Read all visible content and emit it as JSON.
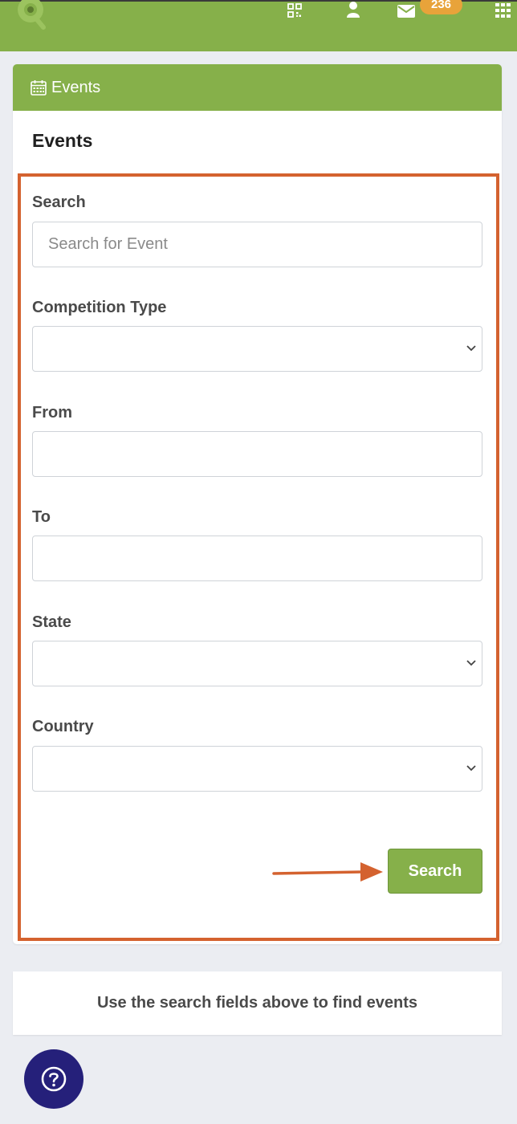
{
  "topbar": {
    "icons": [
      "logo-icon",
      "qr-code-icon",
      "user-icon",
      "mail-icon",
      "apps-grid-icon"
    ],
    "mail_badge": "236",
    "color": "#86b04a"
  },
  "card": {
    "header_label": "Events",
    "title": "Events"
  },
  "form": {
    "search": {
      "label": "Search",
      "placeholder": "Search for Event",
      "value": ""
    },
    "competition_type": {
      "label": "Competition Type",
      "value": ""
    },
    "from": {
      "label": "From",
      "value": ""
    },
    "to": {
      "label": "To",
      "value": ""
    },
    "state": {
      "label": "State",
      "value": ""
    },
    "country": {
      "label": "Country",
      "value": ""
    },
    "submit_label": "Search"
  },
  "info": {
    "message": "Use the search fields above to find events"
  },
  "colors": {
    "accent": "#86b04a",
    "highlight": "#d4622f",
    "badge": "#e8a33a",
    "help": "#25207a"
  }
}
